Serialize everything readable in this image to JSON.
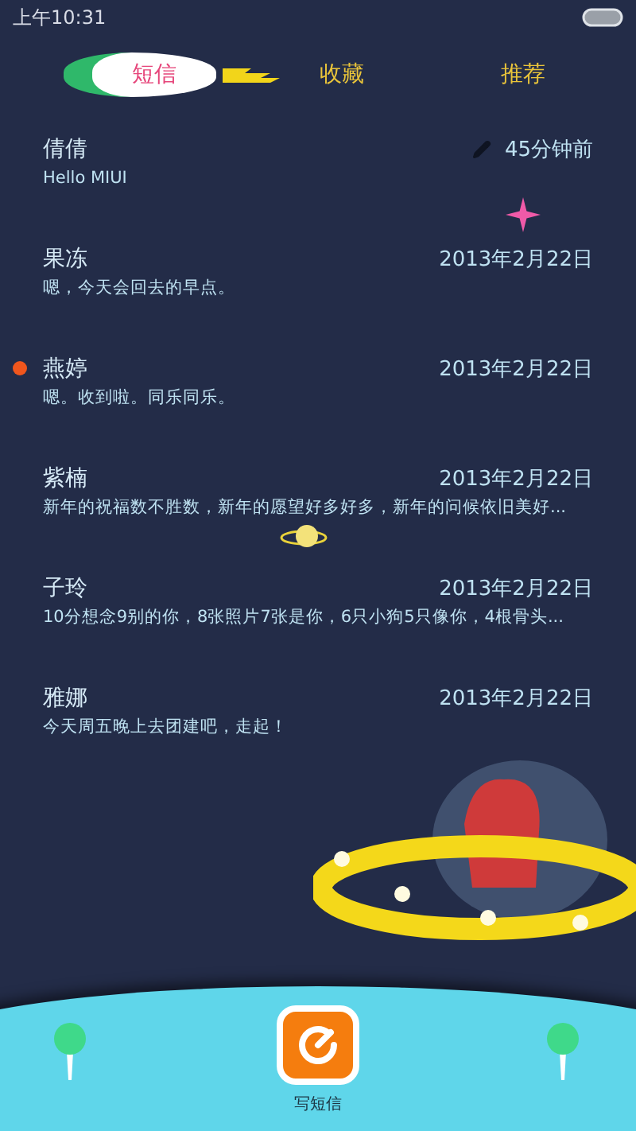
{
  "status_bar": {
    "time": "上午10:31"
  },
  "tabs": [
    {
      "label": "短信",
      "selected": true
    },
    {
      "label": "收藏",
      "selected": false
    },
    {
      "label": "推荐",
      "selected": false
    }
  ],
  "messages": [
    {
      "name": "倩倩",
      "preview": "Hello MIUI",
      "time": "45分钟前",
      "draft": true,
      "unread": false
    },
    {
      "name": "果冻",
      "preview": "嗯，今天会回去的早点。",
      "time": "2013年2月22日",
      "draft": false,
      "unread": false
    },
    {
      "name": "燕婷",
      "preview": "嗯。收到啦。同乐同乐。",
      "time": "2013年2月22日",
      "draft": false,
      "unread": true
    },
    {
      "name": "紫楠",
      "preview": "新年的祝福数不胜数，新年的愿望好多好多，新年的问候依旧美好...",
      "time": "2013年2月22日",
      "draft": false,
      "unread": false
    },
    {
      "name": "子玲",
      "preview": "10分想念9别的你，8张照片7张是你，6只小狗5只像你，4根骨头...",
      "time": "2013年2月22日",
      "draft": false,
      "unread": false
    },
    {
      "name": "雅娜",
      "preview": "今天周五晚上去团建吧，走起！",
      "time": "2013年2月22日",
      "draft": false,
      "unread": false
    }
  ],
  "compose": {
    "label": "写短信"
  }
}
